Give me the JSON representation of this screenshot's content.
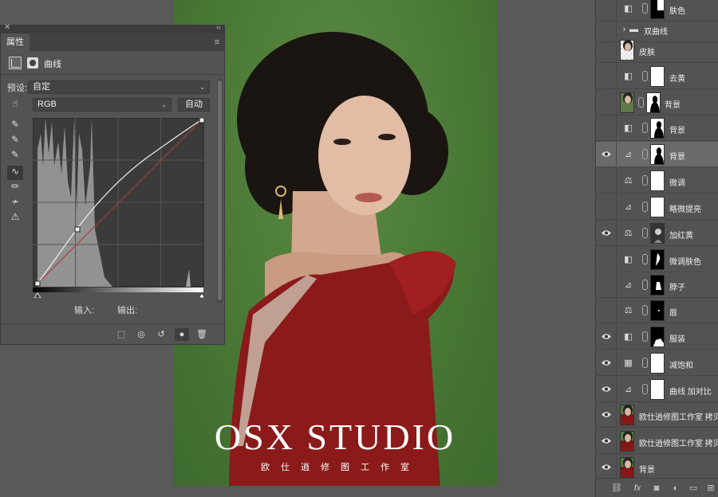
{
  "properties": {
    "tab_label": "属性",
    "close_glyph": "✕",
    "collapse_glyph": "‹‹",
    "menu_glyph": "≡",
    "adjustment_name": "曲线",
    "preset_label": "预设:",
    "preset_value": "自定",
    "channel_value": "RGB",
    "auto_label": "自动",
    "input_label": "输入:",
    "output_label": "输出:"
  },
  "photo": {
    "studio_title": "OSX STUDIO",
    "studio_subtitle": "欧仕逍修图工作室"
  },
  "layers": [
    {
      "name": "肤色",
      "visible": false,
      "type": "mask-partial"
    },
    {
      "name": "双曲线",
      "visible": false,
      "type": "group"
    },
    {
      "name": "皮肤",
      "visible": false,
      "type": "empty"
    },
    {
      "name": "去黄",
      "visible": false,
      "type": "solid-white"
    },
    {
      "name": "背景",
      "visible": false,
      "type": "color-fill"
    },
    {
      "name": "背景",
      "visible": false,
      "type": "adj-silhouette"
    },
    {
      "name": "背景",
      "visible": true,
      "type": "curves-silhouette",
      "selected": true
    },
    {
      "name": "微调",
      "visible": false,
      "type": "balance-white"
    },
    {
      "name": "略微提亮",
      "visible": false,
      "type": "curves-white"
    },
    {
      "name": "加红黄",
      "visible": true,
      "type": "balance-portrait"
    },
    {
      "name": "微调肤色",
      "visible": false,
      "type": "hue-face"
    },
    {
      "name": "脖子",
      "visible": false,
      "type": "curves-neck"
    },
    {
      "name": "唇",
      "visible": false,
      "type": "balance-dot"
    },
    {
      "name": "服装",
      "visible": true,
      "type": "hue-dress"
    },
    {
      "name": "减饱和",
      "visible": true,
      "type": "sat-white"
    },
    {
      "name": "曲线 加对比",
      "visible": true,
      "type": "curves-white"
    },
    {
      "name": "欧仕逍修图工作室 拷贝",
      "visible": true,
      "type": "image"
    },
    {
      "name": "欧仕逍修图工作室 拷贝",
      "visible": true,
      "type": "image"
    },
    {
      "name": "背景",
      "visible": true,
      "type": "image"
    }
  ],
  "layers_footer_icons": [
    "link-icon",
    "fx-icon",
    "mask-icon",
    "adjustment-icon",
    "group-icon",
    "new-layer-icon"
  ],
  "colors": {
    "panel_bg": "#535353",
    "photo_green": "#4a7836",
    "dress_red": "#8b1a1a",
    "selected_row": "#6a6a6a"
  }
}
